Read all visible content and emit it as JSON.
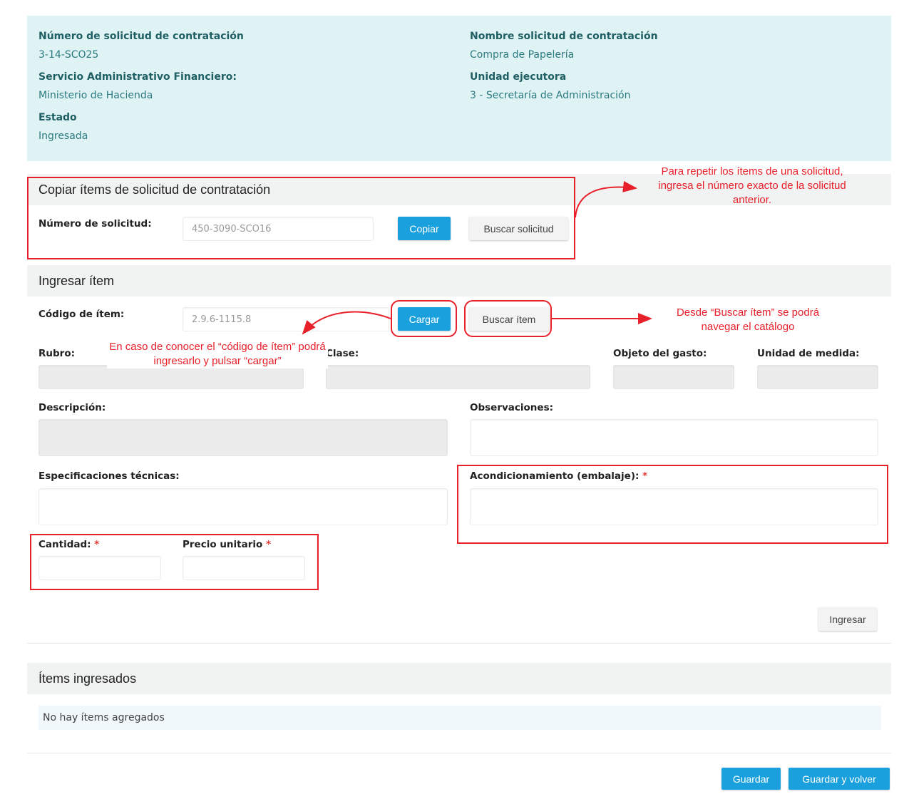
{
  "info": {
    "solicitud_numero": {
      "label": "Número de solicitud de contratación",
      "value": "3-14-SCO25"
    },
    "solicitud_nombre": {
      "label": "Nombre solicitud de contratación",
      "value": "Compra de Papelería"
    },
    "servicio": {
      "label": "Servicio Administrativo Financiero:",
      "value": "Ministerio de Hacienda"
    },
    "unidad": {
      "label": "Unidad ejecutora",
      "value": "3 - Secretaría de Administración"
    },
    "estado": {
      "label": "Estado",
      "value": "Ingresada"
    }
  },
  "copiar": {
    "title": "Copiar ítems de solicitud de contratación",
    "numero_label": "Número de solicitud:",
    "numero_value": "450-3090-SCO16",
    "copiar_btn": "Copiar",
    "buscar_btn": "Buscar solicitud"
  },
  "ingresar": {
    "title": "Ingresar ítem",
    "codigo_label": "Código de ítem:",
    "codigo_value": "2.9.6-1115.8",
    "cargar_btn": "Cargar",
    "buscar_btn": "Buscar ítem",
    "rubro_label": "Rubro:",
    "clase_label": "Clase:",
    "objeto_label": "Objeto del gasto:",
    "unidad_label": "Unidad de medida:",
    "descripcion_label": "Descripción:",
    "observaciones_label": "Observaciones:",
    "especificaciones_label": "Especificaciones técnicas:",
    "acondicionamiento_label": "Acondicionamiento (embalaje):",
    "cantidad_label": "Cantidad:",
    "precio_label": "Precio unitario",
    "required_mark": "*",
    "ingresar_btn": "Ingresar"
  },
  "items": {
    "title": "Ítems ingresados",
    "empty": "No hay ítems agregados"
  },
  "footer": {
    "guardar_btn": "Guardar",
    "guardar_volver_btn": "Guardar y volver"
  },
  "annotations": {
    "repetir": "Para repetir los ítems de una solicitud, ingresa el número exacto de la solicitud anterior.",
    "buscar_item": "Desde “Buscar ítem” se podrá navegar el catálogo",
    "codigo_item": "En caso de conocer el “código de ítem” podrá ingresarlo y pulsar “cargar”"
  },
  "colors": {
    "primary": "#1aa0dd",
    "annotation": "#e8202a",
    "info_panel": "#dff2f4"
  }
}
